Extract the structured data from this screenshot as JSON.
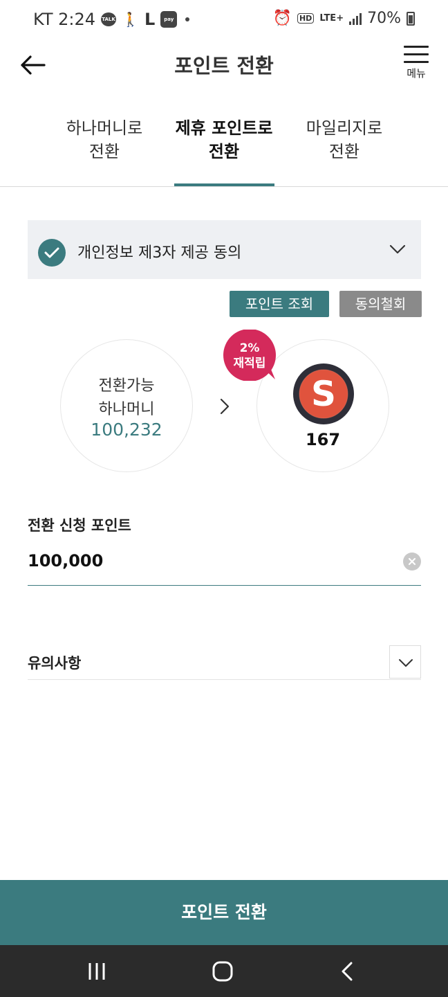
{
  "status_bar": {
    "carrier_time": "KT 2:24",
    "talk_label": "TALK",
    "pay_label": "pay",
    "hd_label": "HD",
    "lte_label": "LTE+",
    "battery_percent": "70%"
  },
  "header": {
    "title": "포인트 전환",
    "menu_label": "메뉴"
  },
  "tabs": [
    {
      "line1": "하나머니로",
      "line2": "전환",
      "active": false
    },
    {
      "line1": "제휴 포인트로",
      "line2": "전환",
      "active": true
    },
    {
      "line1": "마일리지로",
      "line2": "전환",
      "active": false
    }
  ],
  "consent": {
    "label": "개인정보 제3자 제공 동의",
    "checked": true
  },
  "buttons": {
    "inquiry": "포인트 조회",
    "withdraw": "동의철회"
  },
  "hanamoney": {
    "line1": "전환가능",
    "line2": "하나머니",
    "amount": "100,232"
  },
  "partner": {
    "points": "167",
    "logo_letter": "S"
  },
  "badge": {
    "line1": "2%",
    "line2": "재적립"
  },
  "request": {
    "label": "전환 신청 포인트",
    "value": "100,000"
  },
  "notice": {
    "label": "유의사항"
  },
  "cta": {
    "label": "포인트 전환"
  },
  "colors": {
    "accent": "#3b7b7f",
    "badge": "#d42a5b",
    "logo_red": "#e0533d",
    "logo_ring": "#2e2e38"
  }
}
